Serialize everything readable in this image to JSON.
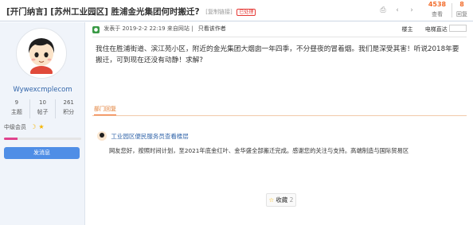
{
  "thread": {
    "tag1": "[开门纳言]",
    "tag2": "[苏州工业园区]",
    "title": "胜浦金光集团何时搬迁?",
    "copy_link": "[复制链接]",
    "hot_badge": "已处理"
  },
  "stats": {
    "views_num": "4538",
    "views_label": "查看",
    "replies_num": "8",
    "replies_label": "回复"
  },
  "icons": [
    "print-icon",
    "previous-icon",
    "next-icon"
  ],
  "user": {
    "name": "Wywexcmplecom",
    "topics_num": "9",
    "topics_label": "主题",
    "posts_num": "10",
    "posts_label": "帖子",
    "points_num": "261",
    "points_label": "积分",
    "group": "中级会员",
    "level_fraction": 0.18,
    "message_button": "发消息"
  },
  "post_meta": {
    "published_prefix": "发表于",
    "published_time": "2019-2-2 22:19",
    "source": "来自网站",
    "only_author": "只看该作者",
    "floor": "楼主",
    "goto_label": "电梯直达"
  },
  "post_body": "我住在胜浦街道、滨江苑小区，附近的金光集团大烟囱一年四季，不分昼夜的冒着烟。我们是深受其害！听说2018年要搬迁，可到现在还没有动静！求解?",
  "reply": {
    "tab_label": "部门回复",
    "dept_name": "工业园区便民服务员查看楼层",
    "body": "网友您好，按照时间计划，至2021年底金红叶、金华盛全部搬迁完成。感谢您的关注与支持。高端制造与国际贸易区"
  },
  "favorite": {
    "label": "收藏",
    "count": "2"
  },
  "colors": {
    "accent": "#f26c2b",
    "link": "#3366aa",
    "button": "#4f8ee6",
    "level_bar": "#e0438d"
  }
}
